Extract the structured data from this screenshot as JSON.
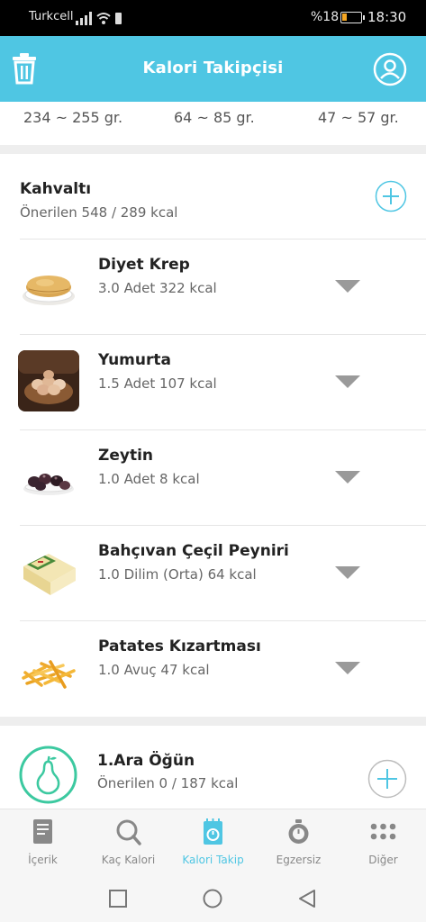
{
  "status_bar": {
    "carrier": "Turkcell",
    "battery_percent": "%18",
    "time": "18:30"
  },
  "app_bar": {
    "title": "Kalori Takipçisi"
  },
  "macros": {
    "carb": "234 ~ 255 gr.",
    "protein": "64 ~ 85 gr.",
    "fat": "47 ~ 57 gr."
  },
  "breakfast": {
    "title": "Kahvaltı",
    "summary": "Önerilen 548 / 289 kcal",
    "items": [
      {
        "name": "Diyet Krep",
        "detail": "3.0 Adet 322 kcal",
        "icon": "crepe-image"
      },
      {
        "name": "Yumurta",
        "detail": "1.5 Adet 107 kcal",
        "icon": "eggs-image"
      },
      {
        "name": "Zeytin",
        "detail": "1.0 Adet 8 kcal",
        "icon": "olives-image"
      },
      {
        "name": "Bahçıvan Çeçil Peyniri",
        "detail": "1.0 Dilim (Orta) 64 kcal",
        "icon": "cheese-image"
      },
      {
        "name": "Patates Kızartması",
        "detail": "1.0 Avuç 47 kcal",
        "icon": "fries-image"
      }
    ]
  },
  "snack": {
    "title": "1.Ara Öğün",
    "summary": "Önerilen 0 / 187 kcal"
  },
  "bottom_nav": {
    "items": [
      {
        "label": "İçerik",
        "icon": "document-icon"
      },
      {
        "label": "Kaç Kalori",
        "icon": "search-icon"
      },
      {
        "label": "Kalori Takip",
        "icon": "calorie-tracker-icon"
      },
      {
        "label": "Egzersiz",
        "icon": "stopwatch-icon"
      },
      {
        "label": "Diğer",
        "icon": "more-dots-icon"
      }
    ],
    "active_index": 2
  },
  "colors": {
    "accent": "#4fc6e3",
    "snack_accent": "#3cc9a0",
    "caret": "#9a9a9a"
  }
}
